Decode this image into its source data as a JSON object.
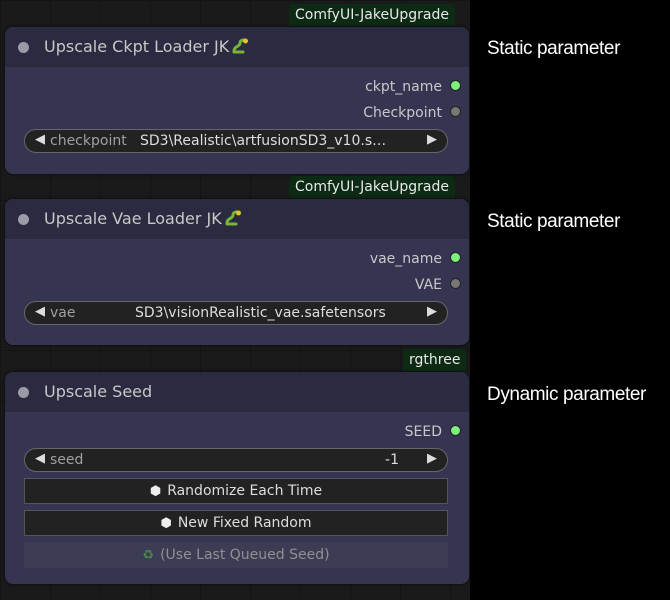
{
  "nodes": [
    {
      "source": "ComfyUI-JakeUpgrade",
      "title": "Upscale Ckpt Loader JK",
      "outputs": [
        {
          "label": "ckpt_name",
          "color": "#7ef07e"
        },
        {
          "label": "Checkpoint",
          "color": "#777777"
        }
      ],
      "widget": {
        "name": "checkpoint",
        "value": "SD3\\Realistic\\artfusionSD3_v10.s…"
      },
      "side_label": "Static parameter"
    },
    {
      "source": "ComfyUI-JakeUpgrade",
      "title": "Upscale Vae Loader JK",
      "outputs": [
        {
          "label": "vae_name",
          "color": "#7ef07e"
        },
        {
          "label": "VAE",
          "color": "#777777"
        }
      ],
      "widget": {
        "name": "vae",
        "value": "SD3\\visionRealistic_vae.safetensors"
      },
      "side_label": "Static parameter"
    },
    {
      "source": "rgthree",
      "title": "Upscale Seed",
      "outputs": [
        {
          "label": "SEED",
          "color": "#7ef07e"
        }
      ],
      "widget": {
        "name": "seed",
        "value": "-1"
      },
      "buttons": {
        "randomize": "Randomize Each Time",
        "new_fixed": "New Fixed Random",
        "use_last": "(Use Last Queued Seed)"
      },
      "side_label": "Dynamic parameter"
    }
  ]
}
